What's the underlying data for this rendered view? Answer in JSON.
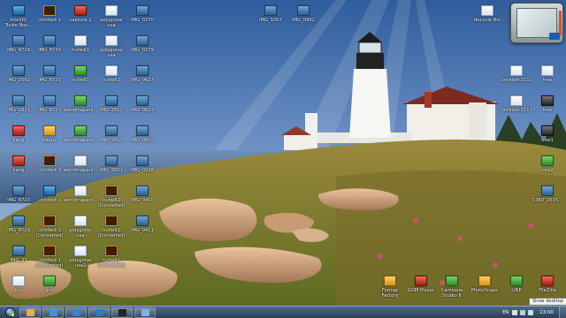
{
  "desktop_icons": [
    {
      "label": "Intel(R)\nTurbo Boo...",
      "kind": "app"
    },
    {
      "label": "Untitled-1",
      "kind": "ai"
    },
    {
      "label": "capture-1",
      "kind": "red"
    },
    {
      "label": "polygonal\nusa",
      "kind": "doc"
    },
    {
      "label": "IMG_0270",
      "kind": "pic"
    },
    {
      "label": "IMG_1007",
      "kind": "pic"
    },
    {
      "label": "IMG_0992",
      "kind": "pic"
    },
    {
      "label": "Recycle Bin",
      "kind": "doc"
    },
    {
      "label": "IMG_8729",
      "kind": "pic"
    },
    {
      "label": "IMG_8739",
      "kind": "pic"
    },
    {
      "label": "hutie61",
      "kind": "doc"
    },
    {
      "label": "polygonal\nusa",
      "kind": "doc"
    },
    {
      "label": "IMG_0279",
      "kind": "pic"
    },
    {
      "label": "IMG_2592",
      "kind": "pic"
    },
    {
      "label": "IMG_8725",
      "kind": "pic"
    },
    {
      "label": "hutie61",
      "kind": "grn"
    },
    {
      "label": "hutie61",
      "kind": "doc"
    },
    {
      "label": "IMG_0627",
      "kind": "pic"
    },
    {
      "label": "Untitled-1111",
      "kind": "doc"
    },
    {
      "label": "tree",
      "kind": "doc"
    },
    {
      "label": "IMG_2821",
      "kind": "pic"
    },
    {
      "label": "IMG_8723",
      "kind": "pic"
    },
    {
      "label": "worldmapani...",
      "kind": "grn"
    },
    {
      "label": "IMG_2812",
      "kind": "pic"
    },
    {
      "label": "IMG_0623",
      "kind": "pic"
    },
    {
      "label": "Untitled-1111",
      "kind": "doc"
    },
    {
      "label": "tree",
      "kind": "dark"
    },
    {
      "label": "kang",
      "kind": "red"
    },
    {
      "label": "happy",
      "kind": "ico"
    },
    {
      "label": "worldmapani...",
      "kind": "grn"
    },
    {
      "label": "IMG_2813",
      "kind": "pic"
    },
    {
      "label": "IMG_0615",
      "kind": "pic"
    },
    {
      "label": "tree1",
      "kind": "dark"
    },
    {
      "label": "kang",
      "kind": "red"
    },
    {
      "label": "Untitled-1",
      "kind": "ai"
    },
    {
      "label": "worldmapani...",
      "kind": "doc"
    },
    {
      "label": "IMG_2821",
      "kind": "pic"
    },
    {
      "label": "IMG_0928",
      "kind": "pic"
    },
    {
      "label": "tree2",
      "kind": "grn"
    },
    {
      "label": "IMG_8720",
      "kind": "pic"
    },
    {
      "label": "Untitled-1",
      "kind": "app"
    },
    {
      "label": "worldmapani...",
      "kind": "doc"
    },
    {
      "label": "hutie61\n(Converted)",
      "kind": "ai"
    },
    {
      "label": "IMG_0410",
      "kind": "pic"
    },
    {
      "label": "C360_2015...",
      "kind": "pic"
    },
    {
      "label": "IMG_8719",
      "kind": "pic"
    },
    {
      "label": "Untitled-1\n(Converted)",
      "kind": "ai"
    },
    {
      "label": "polygonal\nusa",
      "kind": "doc"
    },
    {
      "label": "hutie61\n(Converted)",
      "kind": "ai"
    },
    {
      "label": "IMG_0411",
      "kind": "pic"
    },
    {
      "label": "IMG_33",
      "kind": "pic"
    },
    {
      "label": "Untitled-1\n(Converted)",
      "kind": "ai"
    },
    {
      "label": "polygonal\nusa2",
      "kind": "doc"
    },
    {
      "label": "hutie61\n(Converted)",
      "kind": "ai"
    },
    {
      "label": "bin",
      "kind": "doc"
    },
    {
      "label": "god",
      "kind": "grn"
    },
    {
      "label": "Format\nFactory",
      "kind": "ico"
    },
    {
      "label": "GOM Player",
      "kind": "red"
    },
    {
      "label": "Camtasia\nStudio 8",
      "kind": "grn"
    },
    {
      "label": "PhotoScape",
      "kind": "ico"
    },
    {
      "label": "LINE",
      "kind": "grn"
    },
    {
      "label": "FileZilla",
      "kind": "red"
    }
  ],
  "taskbar": {
    "apps": [
      {
        "name": "explorer",
        "color": "#e2b23c"
      },
      {
        "name": "chrome",
        "color": "#4a90d9"
      },
      {
        "name": "ie",
        "color": "#3a7fd1"
      },
      {
        "name": "media",
        "color": "#2d7cc0"
      },
      {
        "name": "cmd",
        "color": "#222222"
      },
      {
        "name": "app6",
        "color": "#7fb0e0"
      }
    ],
    "language": "EN",
    "clock": "13:00",
    "tooltip": "Show desktop"
  }
}
